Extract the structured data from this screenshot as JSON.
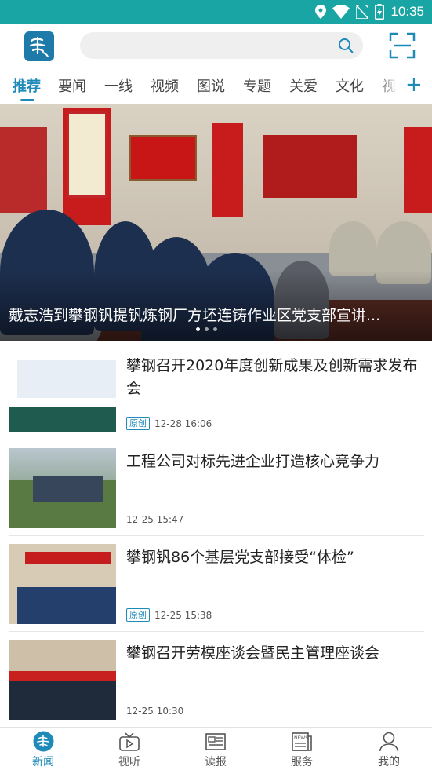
{
  "status_bar": {
    "time": "10:35"
  },
  "header": {
    "logo_icon": "brand-logo-icon",
    "search": {
      "placeholder": "",
      "value": ""
    },
    "scan_icon": "scan-icon"
  },
  "tabs": {
    "items": [
      {
        "label": "推荐",
        "active": true
      },
      {
        "label": "要闻"
      },
      {
        "label": "一线"
      },
      {
        "label": "视频"
      },
      {
        "label": "图说"
      },
      {
        "label": "专题"
      },
      {
        "label": "关爱"
      },
      {
        "label": "文化"
      },
      {
        "label": "视"
      }
    ],
    "add_label": "+"
  },
  "hero": {
    "caption": "戴志浩到攀钢钒提钒炼钢厂方坯连铸作业区党支部宣讲...",
    "slides": 3,
    "current_slide": 1
  },
  "news": [
    {
      "title": "攀钢召开2020年度创新成果及创新需求发布会",
      "badge": "原创",
      "time": "12-28 16:06"
    },
    {
      "title": "工程公司对标先进企业打造核心竞争力",
      "badge": "",
      "time": "12-25 15:47"
    },
    {
      "title": "攀钢钒86个基层党支部接受“体检”",
      "badge": "原创",
      "time": "12-25 15:38"
    },
    {
      "title": "攀钢召开劳模座谈会暨民主管理座谈会",
      "badge": "",
      "time": "12-25 10:30"
    }
  ],
  "bottom_nav": [
    {
      "label": "新闻",
      "icon": "news-logo-icon",
      "active": true
    },
    {
      "label": "视听",
      "icon": "tv-icon"
    },
    {
      "label": "读报",
      "icon": "newspaper-icon"
    },
    {
      "label": "服务",
      "icon": "news-service-icon"
    },
    {
      "label": "我的",
      "icon": "user-icon"
    }
  ],
  "colors": {
    "accent": "#1e8ab8",
    "status_bar": "#1aa5a5"
  }
}
